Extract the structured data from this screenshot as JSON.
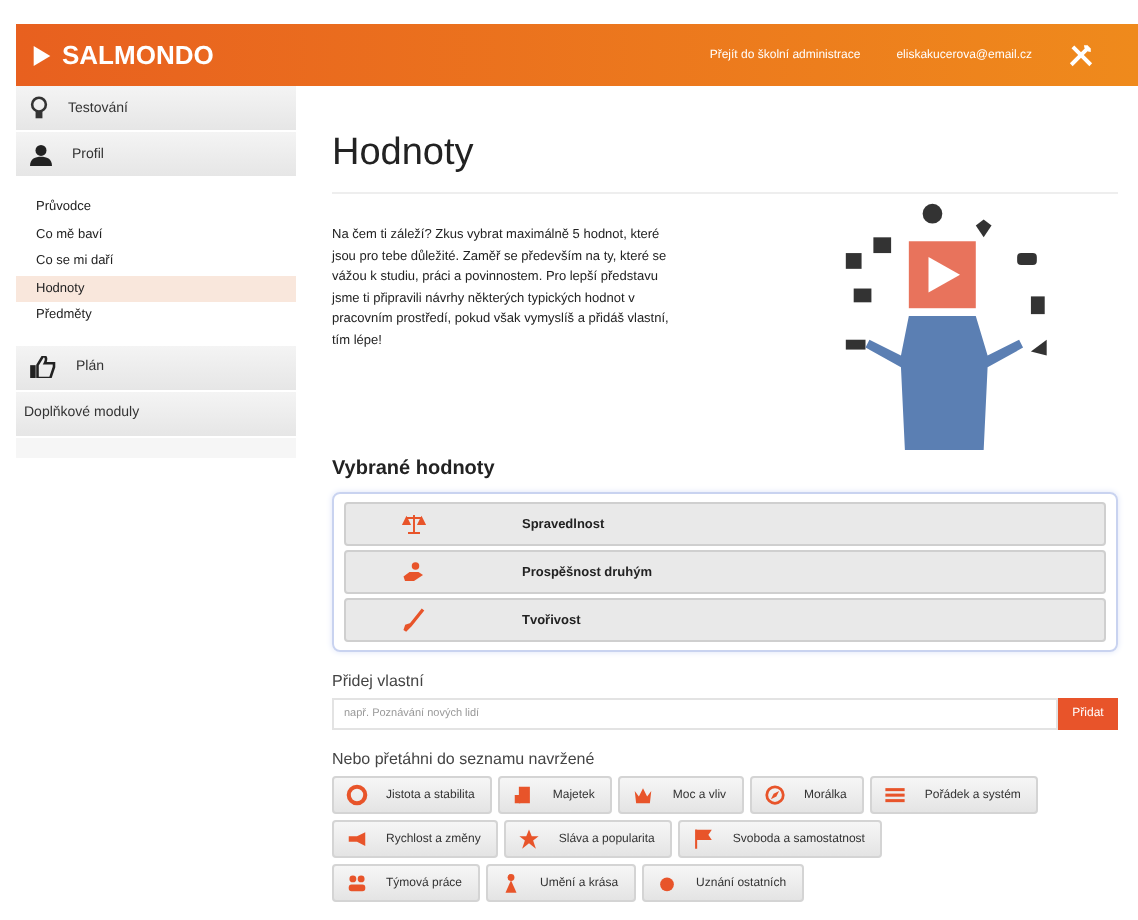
{
  "header": {
    "logo": "SALMONDO",
    "links": [
      "Přejít do školní administrace",
      "eliskakucerova@email.cz"
    ]
  },
  "sidebar": {
    "sections": [
      {
        "label": "Testování"
      },
      {
        "label": "Profil",
        "items": [
          {
            "label": "Průvodce",
            "selected": false
          },
          {
            "label": "Co mě baví",
            "selected": false
          },
          {
            "label": "Co se mi daří",
            "selected": false
          },
          {
            "label": "Hodnoty",
            "selected": true
          },
          {
            "label": "Předměty",
            "selected": false
          }
        ]
      },
      {
        "label": "Plán"
      },
      {
        "label": "Doplňkové moduly"
      }
    ]
  },
  "page": {
    "title": "Hodnoty",
    "intro": "Na čem ti záleží? Zkus vybrat maximálně 5 hodnot, které jsou pro tebe důležité. Zaměř se především na ty, které se vážou k studiu, práci a povinnostem. Pro lepší představu jsme ti připravili návrhy některých typických hodnot v pracovním prostředí, pokud však vymyslíš a přidáš vlastní, tím lépe!"
  },
  "selected_values": {
    "heading": "Vybrané hodnoty",
    "items": [
      "Spravedlnost",
      "Prospěšnost druhým",
      "Tvořivost"
    ]
  },
  "custom": {
    "label": "Přidej vlastní",
    "placeholder": "např. Poznávání nových lidí",
    "button": "Přidat"
  },
  "suggested": {
    "heading": "Nebo přetáhni do seznamu navržené",
    "rows": [
      [
        "Jistota a stabilita",
        "Majetek",
        "Moc a vliv",
        "Morálka",
        "Pořádek a systém"
      ],
      [
        "Rychlost a změny",
        "Sláva a popularita",
        "Svoboda a samostatnost"
      ],
      [
        "Týmová práce",
        "Umění a krása",
        "Uznání ostatních"
      ]
    ]
  }
}
